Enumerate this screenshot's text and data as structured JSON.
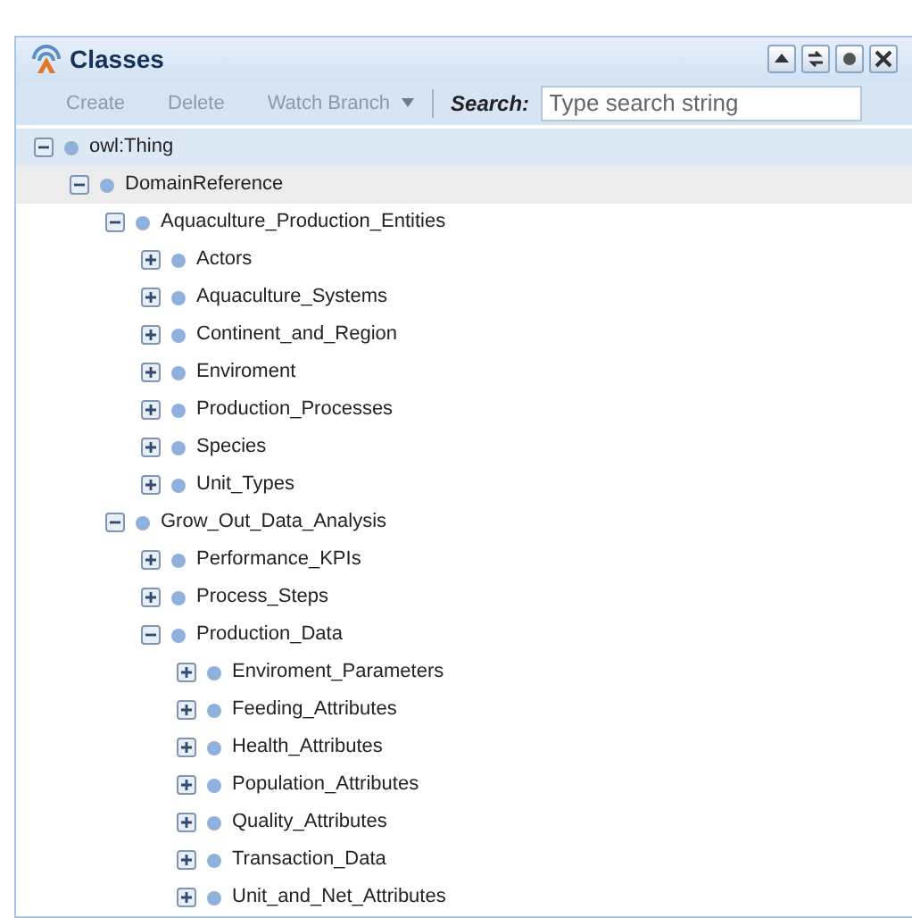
{
  "panel": {
    "title": "Classes",
    "header_buttons": [
      {
        "kind": "collapse"
      },
      {
        "kind": "refresh"
      },
      {
        "kind": "settings"
      },
      {
        "kind": "close"
      }
    ]
  },
  "toolbar": {
    "buttons": [
      {
        "label": "Create",
        "disabled": true
      },
      {
        "label": "Delete",
        "disabled": true
      },
      {
        "label": "Watch Branch",
        "disabled": true,
        "dropdown": true
      }
    ],
    "search_label": "Search:",
    "search_placeholder": "Type search string"
  },
  "tree": [
    {
      "label": "owl:Thing",
      "expanded": true,
      "selected": true,
      "highlighted": false,
      "children": [
        {
          "label": "DomainReference",
          "expanded": true,
          "selected": false,
          "highlighted": true,
          "children": [
            {
              "label": "Aquaculture_Production_Entities",
              "expanded": true,
              "selected": false,
              "highlighted": false,
              "children": [
                {
                  "label": "Actors",
                  "expanded": false,
                  "selected": false,
                  "highlighted": false
                },
                {
                  "label": "Aquaculture_Systems",
                  "expanded": false,
                  "selected": false,
                  "highlighted": false
                },
                {
                  "label": "Continent_and_Region",
                  "expanded": false,
                  "selected": false,
                  "highlighted": false
                },
                {
                  "label": "Enviroment",
                  "expanded": false,
                  "selected": false,
                  "highlighted": false
                },
                {
                  "label": "Production_Processes",
                  "expanded": false,
                  "selected": false,
                  "highlighted": false
                },
                {
                  "label": "Species",
                  "expanded": false,
                  "selected": false,
                  "highlighted": false
                },
                {
                  "label": "Unit_Types",
                  "expanded": false,
                  "selected": false,
                  "highlighted": false
                }
              ]
            },
            {
              "label": "Grow_Out_Data_Analysis",
              "expanded": true,
              "selected": false,
              "highlighted": false,
              "children": [
                {
                  "label": "Performance_KPIs",
                  "expanded": false,
                  "selected": false,
                  "highlighted": false
                },
                {
                  "label": "Process_Steps",
                  "expanded": false,
                  "selected": false,
                  "highlighted": false
                },
                {
                  "label": "Production_Data",
                  "expanded": true,
                  "selected": false,
                  "highlighted": false,
                  "children": [
                    {
                      "label": "Enviroment_Parameters",
                      "expanded": false,
                      "selected": false,
                      "highlighted": false
                    },
                    {
                      "label": "Feeding_Attributes",
                      "expanded": false,
                      "selected": false,
                      "highlighted": false
                    },
                    {
                      "label": "Health_Attributes",
                      "expanded": false,
                      "selected": false,
                      "highlighted": false
                    },
                    {
                      "label": "Population_Attributes",
                      "expanded": false,
                      "selected": false,
                      "highlighted": false
                    },
                    {
                      "label": "Quality_Attributes",
                      "expanded": false,
                      "selected": false,
                      "highlighted": false
                    },
                    {
                      "label": "Transaction_Data",
                      "expanded": false,
                      "selected": false,
                      "highlighted": false
                    },
                    {
                      "label": "Unit_and_Net_Attributes",
                      "expanded": false,
                      "selected": false,
                      "highlighted": false
                    }
                  ]
                }
              ]
            }
          ]
        }
      ]
    }
  ]
}
